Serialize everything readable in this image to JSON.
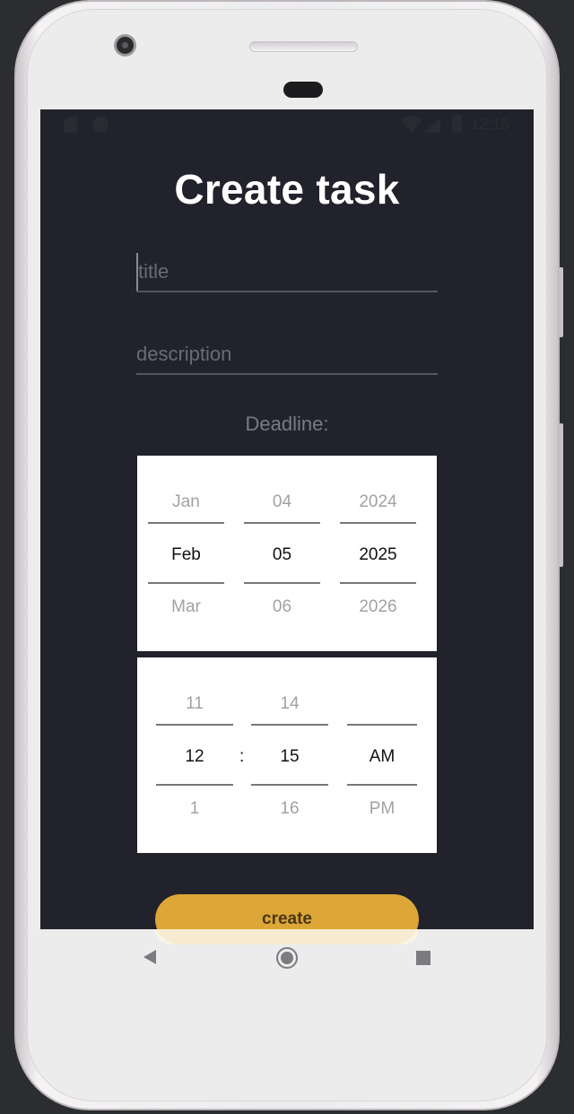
{
  "status_bar": {
    "time": "12:15"
  },
  "screen": {
    "title": "Create task",
    "title_field": {
      "placeholder": "title",
      "value": ""
    },
    "description_field": {
      "placeholder": "description",
      "value": ""
    },
    "deadline_label": "Deadline:",
    "date_picker": {
      "month": {
        "prev": "Jan",
        "selected": "Feb",
        "next": "Mar"
      },
      "day": {
        "prev": "04",
        "selected": "05",
        "next": "06"
      },
      "year": {
        "prev": "2024",
        "selected": "2025",
        "next": "2026"
      }
    },
    "time_picker": {
      "hour": {
        "prev": "11",
        "selected": "12",
        "next": "1"
      },
      "separator": ":",
      "minute": {
        "prev": "14",
        "selected": "15",
        "next": "16"
      },
      "ampm": {
        "prev": "",
        "selected": "AM",
        "next": "PM"
      }
    },
    "create_button_label": "create"
  },
  "nav_icons": [
    "back-icon",
    "home-icon",
    "recents-icon"
  ],
  "colors": {
    "background": "#22222c",
    "accent": "#dda738",
    "picker_bg": "#ffffff"
  }
}
